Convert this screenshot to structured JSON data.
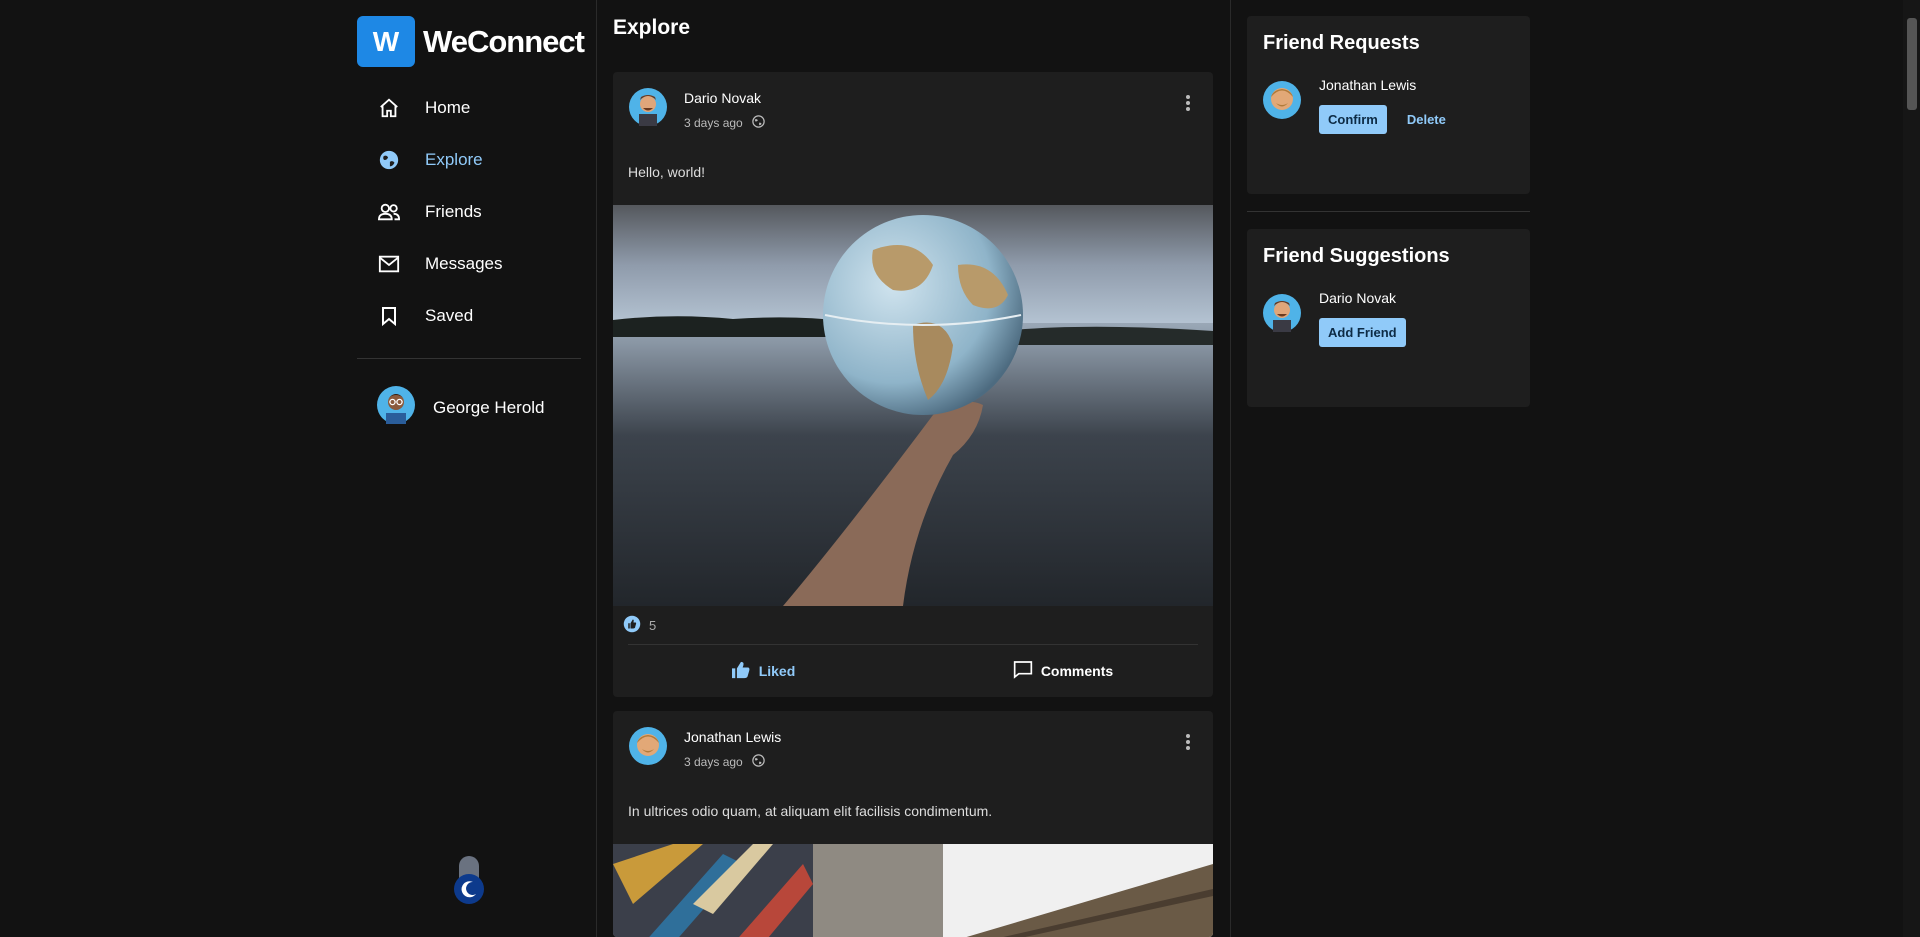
{
  "app": {
    "name": "WeConnect",
    "logo_letter": "W"
  },
  "nav": {
    "items": [
      {
        "label": "Home",
        "icon": "home-icon"
      },
      {
        "label": "Explore",
        "icon": "globe-icon",
        "active": true
      },
      {
        "label": "Friends",
        "icon": "people-icon"
      },
      {
        "label": "Messages",
        "icon": "mail-icon"
      },
      {
        "label": "Saved",
        "icon": "bookmark-icon"
      }
    ],
    "profile_name": "George Herold"
  },
  "page": {
    "title": "Explore"
  },
  "posts": [
    {
      "author": "Dario Novak",
      "time": "3 days ago",
      "text": "Hello, world!",
      "likes": "5",
      "like_label": "Liked",
      "comments_label": "Comments"
    },
    {
      "author": "Jonathan Lewis",
      "time": "3 days ago",
      "text": "In ultrices odio quam, at aliquam elit facilisis condimentum."
    }
  ],
  "friend_requests": {
    "title": "Friend Requests",
    "items": [
      {
        "name": "Jonathan Lewis",
        "confirm_label": "Confirm",
        "delete_label": "Delete"
      }
    ]
  },
  "friend_suggestions": {
    "title": "Friend Suggestions",
    "items": [
      {
        "name": "Dario Novak",
        "add_label": "Add Friend"
      }
    ]
  },
  "colors": {
    "accent": "#90caf9",
    "brand": "#1e88e5",
    "background": "#121212",
    "card": "#1e1e1e"
  }
}
